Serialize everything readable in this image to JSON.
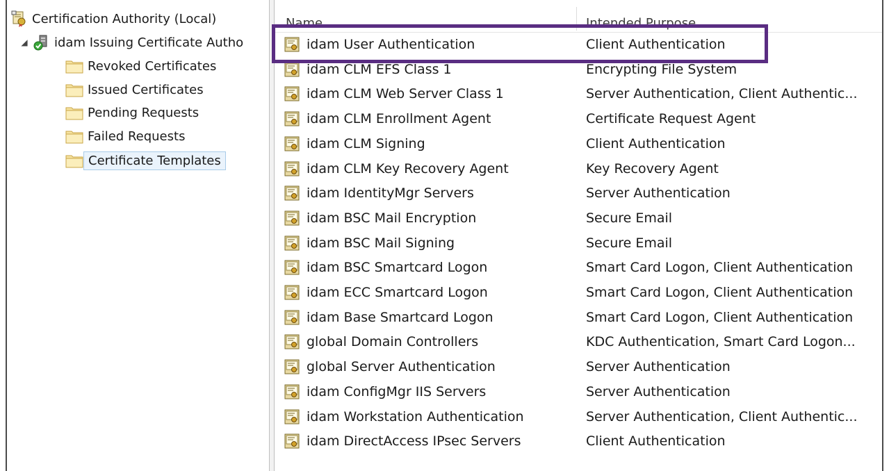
{
  "tree": {
    "root_label": "Certification Authority (Local)",
    "ca_label": "idam Issuing Certificate Autho",
    "children": [
      {
        "label": "Revoked Certificates"
      },
      {
        "label": "Issued Certificates"
      },
      {
        "label": "Pending Requests"
      },
      {
        "label": "Failed Requests"
      },
      {
        "label": "Certificate Templates"
      }
    ]
  },
  "list": {
    "columns": {
      "name": "Name",
      "purpose": "Intended Purpose"
    },
    "rows": [
      {
        "name": "idam User Authentication",
        "purpose": "Client Authentication"
      },
      {
        "name": "idam CLM EFS Class 1",
        "purpose": "Encrypting File System"
      },
      {
        "name": "idam CLM Web Server Class 1",
        "purpose": "Server Authentication, Client Authentic..."
      },
      {
        "name": "idam CLM Enrollment Agent",
        "purpose": "Certificate Request Agent"
      },
      {
        "name": "idam CLM Signing",
        "purpose": "Client Authentication"
      },
      {
        "name": "idam CLM Key Recovery Agent",
        "purpose": "Key Recovery Agent"
      },
      {
        "name": "idam IdentityMgr Servers",
        "purpose": "Server Authentication"
      },
      {
        "name": "idam BSC Mail Encryption",
        "purpose": "Secure Email"
      },
      {
        "name": "idam BSC Mail Signing",
        "purpose": "Secure Email"
      },
      {
        "name": "idam BSC Smartcard Logon",
        "purpose": "Smart Card Logon, Client Authentication"
      },
      {
        "name": "idam ECC Smartcard Logon",
        "purpose": "Smart Card Logon, Client Authentication"
      },
      {
        "name": "idam Base Smartcard Logon",
        "purpose": "Smart Card Logon, Client Authentication"
      },
      {
        "name": "global Domain Controllers",
        "purpose": "KDC Authentication, Smart Card Logon..."
      },
      {
        "name": "global Server Authentication",
        "purpose": "Server Authentication"
      },
      {
        "name": "idam ConfigMgr IIS Servers",
        "purpose": "Server Authentication"
      },
      {
        "name": "idam Workstation Authentication",
        "purpose": "Server Authentication, Client Authentic..."
      },
      {
        "name": "idam DirectAccess IPsec Servers",
        "purpose": "Client Authentication"
      }
    ]
  },
  "icons": {
    "root": "certificate-authority-icon",
    "ca": "ca-server-icon",
    "folder": "folder-icon",
    "template": "certificate-template-icon"
  },
  "colors": {
    "highlight_border": "#5a2d82",
    "selection_bg": "#eaf3fc",
    "selection_border": "#a8cbe8"
  }
}
